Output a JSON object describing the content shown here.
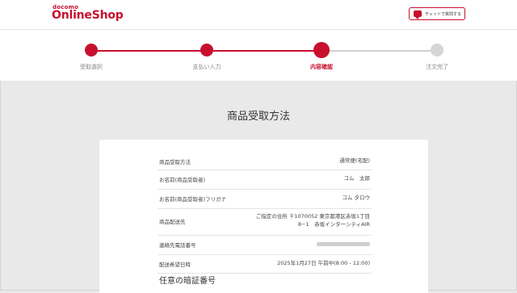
{
  "brand": {
    "small": "docomo",
    "main": "OnlineShop"
  },
  "header": {
    "chat_button": "チャットで質問する",
    "chat_icon": "chat-bubble-icon"
  },
  "steps": [
    {
      "label": "受取選択",
      "state": "done"
    },
    {
      "label": "支払い入力",
      "state": "done"
    },
    {
      "label": "内容確認",
      "state": "current"
    },
    {
      "label": "注文完了",
      "state": "todo"
    }
  ],
  "colors": {
    "accent": "#c8102e",
    "inactive": "#d6d6d6",
    "background": "#e9e9e9"
  },
  "page": {
    "title": "商品受取方法"
  },
  "details": {
    "method": {
      "label": "商品受取方法",
      "value": "通常便(宅配)"
    },
    "name": {
      "label": "お名前(商品受取者)",
      "value": "コム　太郎"
    },
    "kana": {
      "label": "お名前(商品受取者)フリガナ",
      "value": "コム タロウ"
    },
    "address": {
      "label": "商品配送先",
      "line1": "ご指定の住所 〒1070052 東京都港区赤坂1丁目",
      "line2": "8−1　赤坂インターシティAIR"
    },
    "phone": {
      "label": "連絡先電話番号"
    },
    "delivery": {
      "label": "配送希望日時",
      "value": "2025年1月27日 午前中(8:00 - 12:00)"
    }
  },
  "pin_section": {
    "title": "任意の暗証番号"
  }
}
